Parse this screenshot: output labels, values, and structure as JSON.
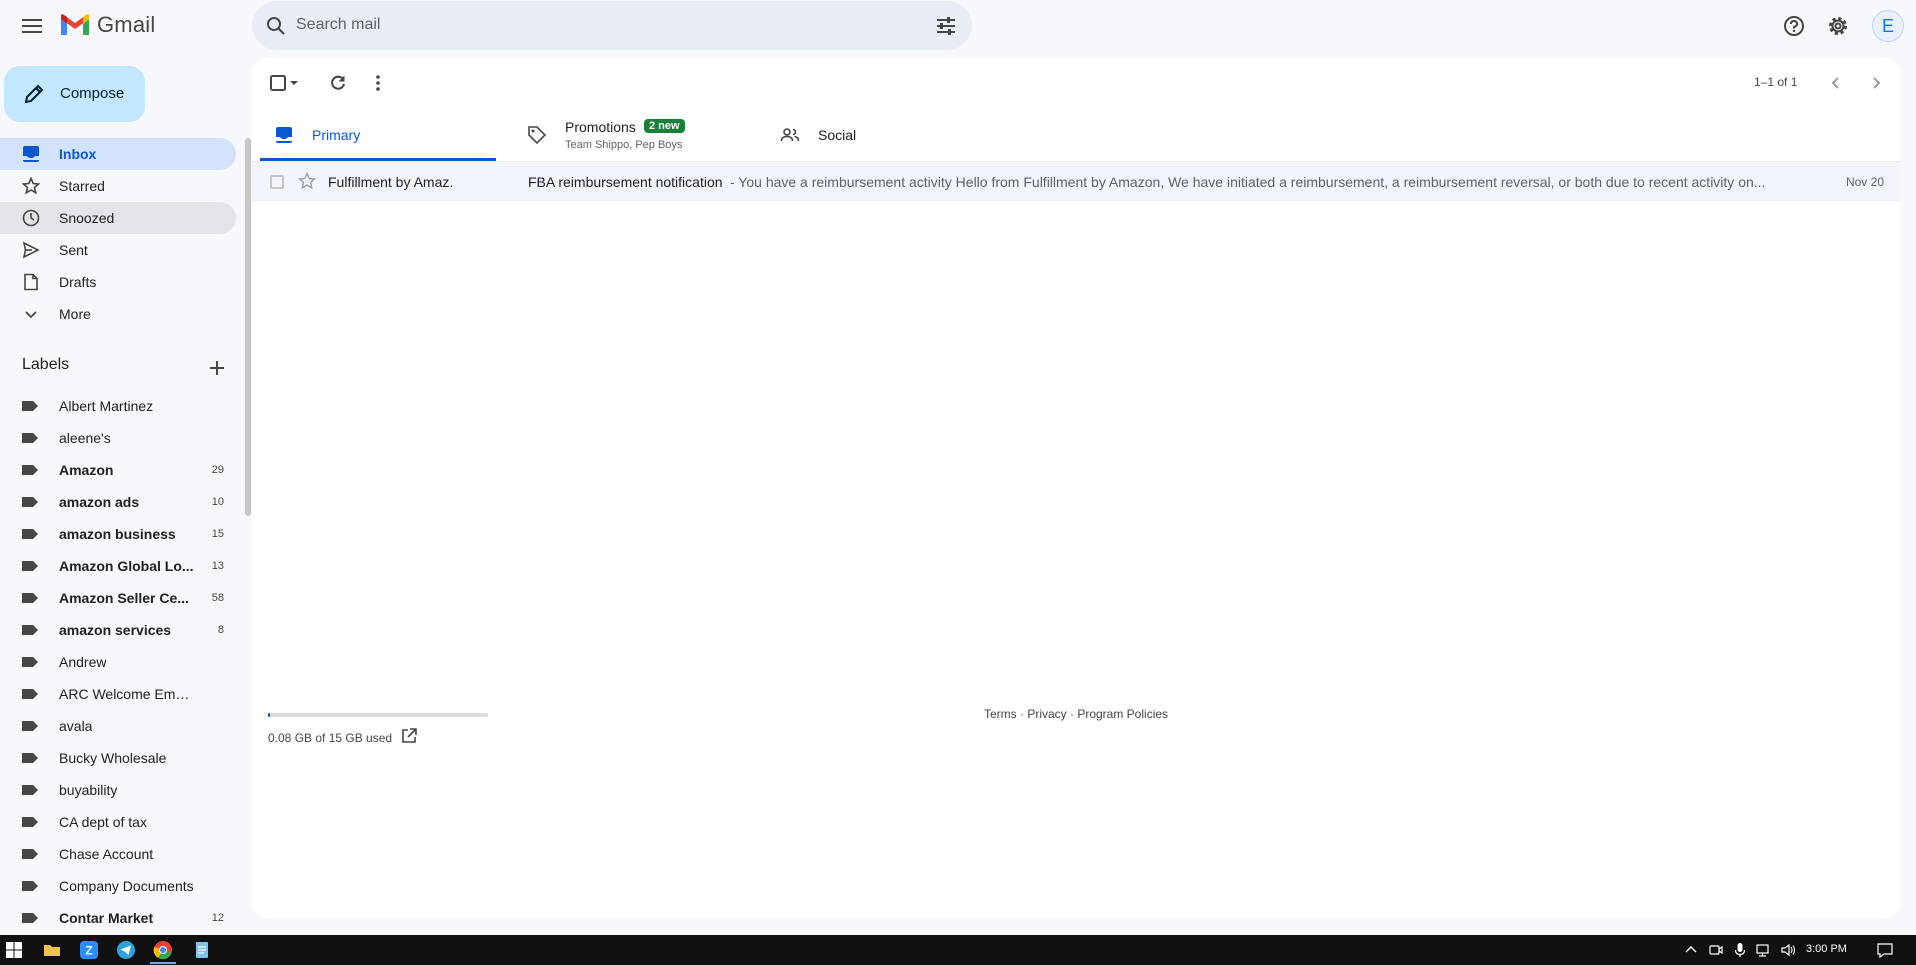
{
  "header": {
    "app_name": "Gmail",
    "search_placeholder": "Search mail",
    "avatar_letter": "E"
  },
  "sidebar": {
    "compose_label": "Compose",
    "nav": [
      {
        "label": "Inbox",
        "icon": "inbox-icon",
        "state": "active"
      },
      {
        "label": "Starred",
        "icon": "star-icon",
        "state": ""
      },
      {
        "label": "Snoozed",
        "icon": "clock-icon",
        "state": "hover"
      },
      {
        "label": "Sent",
        "icon": "send-icon",
        "state": ""
      },
      {
        "label": "Drafts",
        "icon": "draft-icon",
        "state": ""
      },
      {
        "label": "More",
        "icon": "chevron-down-icon",
        "state": ""
      }
    ],
    "labels_title": "Labels",
    "labels": [
      {
        "name": "Albert Martinez",
        "count": "",
        "bold": false
      },
      {
        "name": "aleene's",
        "count": "",
        "bold": false
      },
      {
        "name": "Amazon",
        "count": "29",
        "bold": true
      },
      {
        "name": "amazon ads",
        "count": "10",
        "bold": true
      },
      {
        "name": "amazon business",
        "count": "15",
        "bold": true
      },
      {
        "name": "Amazon Global Lo...",
        "count": "13",
        "bold": true
      },
      {
        "name": "Amazon Seller Ce...",
        "count": "58",
        "bold": true
      },
      {
        "name": "amazon services",
        "count": "8",
        "bold": true
      },
      {
        "name": "Andrew",
        "count": "",
        "bold": false
      },
      {
        "name": "ARC Welcome Emails",
        "count": "",
        "bold": false
      },
      {
        "name": "avala",
        "count": "",
        "bold": false
      },
      {
        "name": "Bucky Wholesale",
        "count": "",
        "bold": false
      },
      {
        "name": "buyability",
        "count": "",
        "bold": false
      },
      {
        "name": "CA dept of tax",
        "count": "",
        "bold": false
      },
      {
        "name": "Chase Account",
        "count": "",
        "bold": false
      },
      {
        "name": "Company Documents",
        "count": "",
        "bold": false
      },
      {
        "name": "Contar Market",
        "count": "12",
        "bold": true
      }
    ]
  },
  "main": {
    "pager_text": "1–1 of 1",
    "tabs": {
      "primary": "Primary",
      "promotions": "Promotions",
      "promotions_badge": "2 new",
      "promotions_sub": "Team Shippo, Pep Boys",
      "social": "Social"
    },
    "emails": [
      {
        "sender": "Fulfillment by Amaz.",
        "subject": "FBA reimbursement notification",
        "snippet": " - You have a reimbursement activity Hello from Fulfillment by Amazon, We have initiated a reimbursement, a reimbursement reversal, or both due to recent activity on...",
        "date": "Nov 20"
      }
    ],
    "storage_text": "0.08 GB of 15 GB used",
    "storage_fraction": 0.005,
    "footer_links": "Terms · Privacy · Program Policies"
  },
  "taskbar": {
    "time": "3:00 PM",
    "apps": [
      "windows-start-icon",
      "file-explorer-icon",
      "zoom-icon",
      "telegram-icon",
      "chrome-icon",
      "notepad-icon"
    ]
  },
  "colors": {
    "accent": "#0b57d0",
    "compose_bg": "#c2e7ff",
    "active_nav_bg": "#d3e3fd",
    "badge_green": "#188038"
  }
}
